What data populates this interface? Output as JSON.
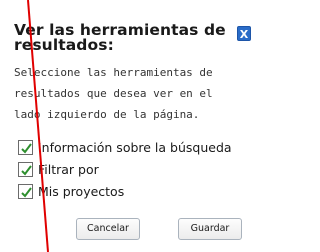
{
  "dialog": {
    "title": "Ver las herramientas de resultados:",
    "close_label": "X",
    "description": "Seleccione las herramientas de resultados que desea ver en el lado izquierdo de la página.",
    "options": [
      {
        "label": "Información sobre la búsqueda",
        "checked": true
      },
      {
        "label": "Filtrar por",
        "checked": true
      },
      {
        "label": "Mis proyectos",
        "checked": true
      }
    ],
    "buttons": {
      "cancel_label": "Cancelar",
      "save_label": "Guardar"
    }
  },
  "colors": {
    "close_button": "#2a6cc8",
    "checkmark": "#2e8f2e",
    "annotation_line": "#e00000"
  }
}
